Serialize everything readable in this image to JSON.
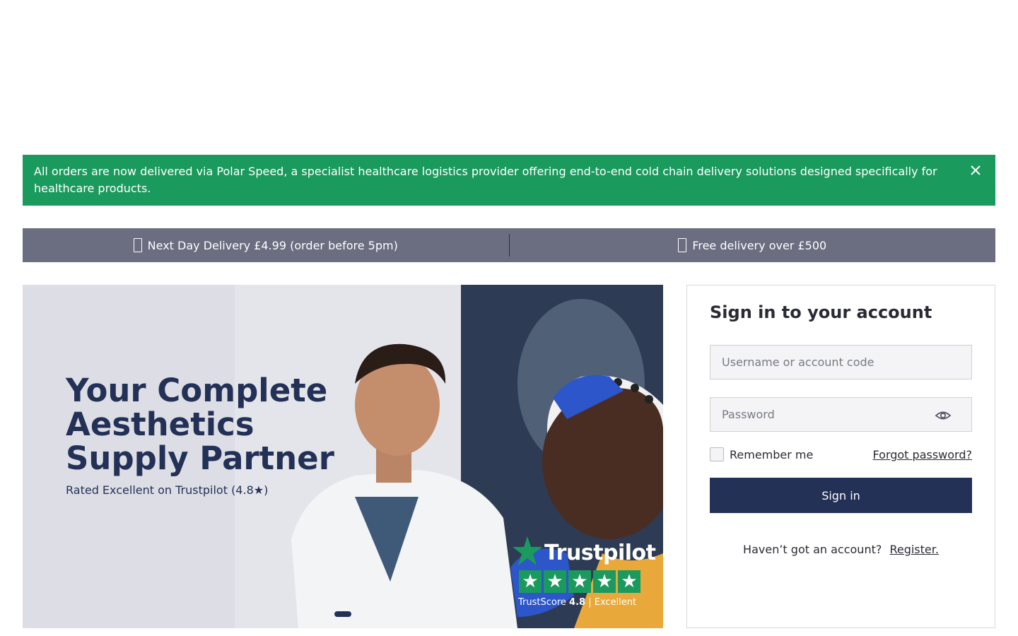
{
  "notice": {
    "text": "All orders are now delivered via Polar Speed, a specialist healthcare logistics provider offering end-to-end cold chain delivery solutions designed specifically for healthcare products.",
    "close_icon": "close-icon",
    "background": "#1b9a5e"
  },
  "delivery_strip": {
    "items": [
      {
        "icon": "box-icon",
        "label": "Next Day Delivery £4.99 (order before 5pm)"
      },
      {
        "icon": "box-icon",
        "label": "Free delivery over £500"
      }
    ],
    "background": "#6b6d80"
  },
  "hero": {
    "title": "Your Complete Aesthetics Supply Partner",
    "subtitle": "Rated Excellent on Trustpilot (4.8★)",
    "carousel_slides": 1,
    "trustpilot": {
      "wordmark": "Trustpilot",
      "stars": 5,
      "score_label": "TrustScore",
      "score": "4.8",
      "separator": "|",
      "rating_word": "Excellent"
    }
  },
  "signin": {
    "title": "Sign in to your account",
    "username_placeholder": "Username or account code",
    "password_placeholder": "Password",
    "show_password_icon": "eye-icon",
    "remember_label": "Remember me",
    "forgot_label": "Forgot password?",
    "button_label": "Sign in",
    "register_prompt": "Haven’t got an account?",
    "register_link": "Register."
  },
  "colors": {
    "navy": "#243157",
    "green": "#1b9a5e",
    "strip_gray": "#6b6d80"
  }
}
